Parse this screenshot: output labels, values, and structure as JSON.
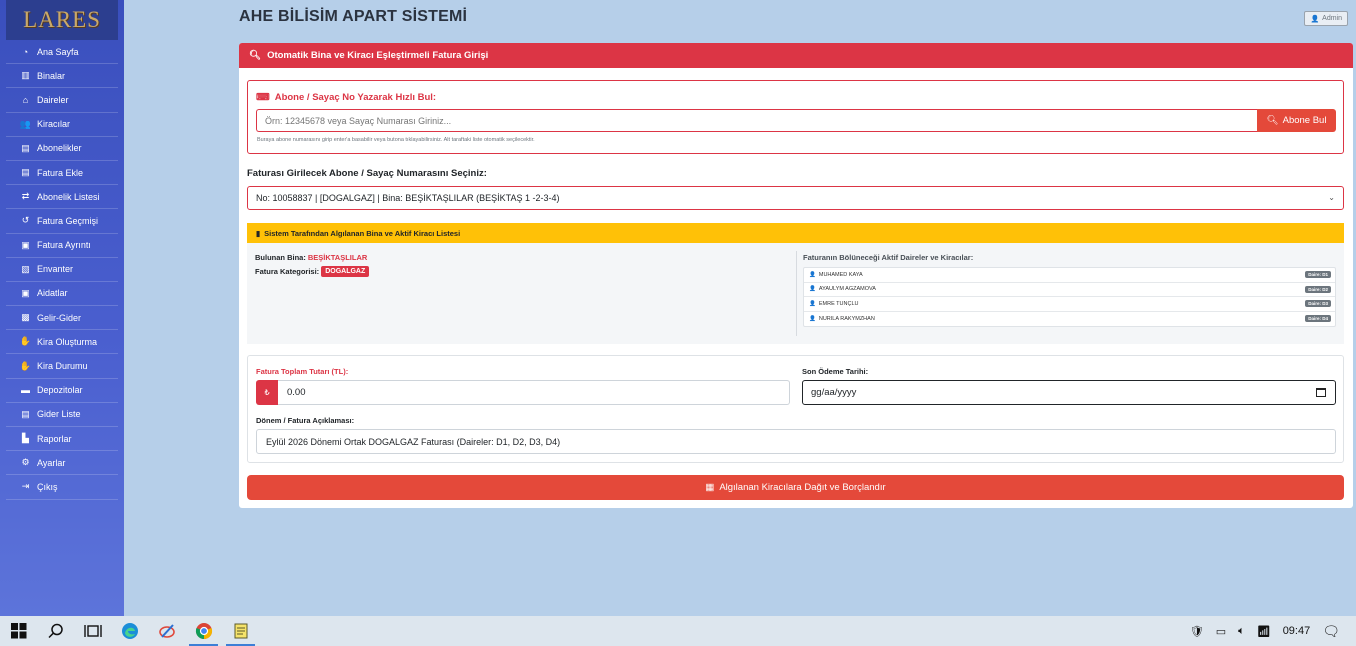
{
  "app": {
    "logo_text": "LARES",
    "page_title": "AHE BİLİSİM APART SİSTEMİ",
    "admin_label": "Admin"
  },
  "sidebar": {
    "items": [
      {
        "label": "Ana Sayfa",
        "icon": "dashboard-icon"
      },
      {
        "label": "Binalar",
        "icon": "building-icon"
      },
      {
        "label": "Daireler",
        "icon": "home-icon"
      },
      {
        "label": "Kiracılar",
        "icon": "users-icon"
      },
      {
        "label": "Abonelikler",
        "icon": "clipboard-icon"
      },
      {
        "label": "Fatura Ekle",
        "icon": "invoice-icon"
      },
      {
        "label": "Abonelik Listesi",
        "icon": "sync-icon"
      },
      {
        "label": "Fatura Geçmişi",
        "icon": "history-icon"
      },
      {
        "label": "Fatura Ayrıntı",
        "icon": "money-icon"
      },
      {
        "label": "Envanter",
        "icon": "box-icon"
      },
      {
        "label": "Aidatlar",
        "icon": "wallet-icon"
      },
      {
        "label": "Gelir-Gider",
        "icon": "cash-icon"
      },
      {
        "label": "Kira Oluşturma",
        "icon": "hand-money-icon"
      },
      {
        "label": "Kira Durumu",
        "icon": "hand-coin-icon"
      },
      {
        "label": "Depozitolar",
        "icon": "deposit-icon"
      },
      {
        "label": "Gider Liste",
        "icon": "list-icon"
      },
      {
        "label": "Raporlar",
        "icon": "chart-icon"
      },
      {
        "label": "Ayarlar",
        "icon": "gear-icon"
      },
      {
        "label": "Çıkış",
        "icon": "logout-icon"
      }
    ]
  },
  "card": {
    "header": "Otomatik Bina ve Kiracı Eşleştirmeli Fatura Girişi"
  },
  "quick_search": {
    "label": "Abone / Sayaç No Yazarak Hızlı Bul:",
    "placeholder": "Örn: 12345678 veya Sayaç Numarası Giriniz...",
    "button": "Abone Bul",
    "help": "Buraya abone numarasını girip enter'a basabilir veya butona tıklayabilirsiniz. Alt taraftaki liste otomatik seçilecektir."
  },
  "subscriber_select": {
    "label": "Faturası Girilecek Abone / Sayaç Numarasını Seçiniz:",
    "value": "No: 10058837 | [DOGALGAZ] | Bina: BEŞİKTAŞLILAR (BEŞİKTAŞ 1 -2-3-4)"
  },
  "detected": {
    "title": "Sistem Tarafından Algılanan Bina ve Aktif Kiracı Listesi",
    "building_label": "Bulunan Bina:",
    "building_value": "BEŞİKTAŞLILAR",
    "category_label": "Fatura Kategorisi:",
    "category_value": "DOGALGAZ",
    "tenants_title": "Faturanın Bölüneceği Aktif Daireler ve Kiracılar:",
    "tenants": [
      {
        "name": "MUHAMED KAYA",
        "badge": "Daire: D1"
      },
      {
        "name": "AYAULYM AGZAMOVA",
        "badge": "Daire: D2"
      },
      {
        "name": "EMRE TUNÇLU",
        "badge": "Daire: D3"
      },
      {
        "name": "NURILA RAKYMZHAN",
        "badge": "Daire: D4"
      }
    ]
  },
  "form": {
    "amount_label": "Fatura Toplam Tutarı (TL):",
    "currency_symbol": "₺",
    "amount_value": "0.00",
    "due_label": "Son Ödeme Tarihi:",
    "due_value": "gg/aa/yyyy",
    "desc_label": "Dönem / Fatura Açıklaması:",
    "desc_value": "Eylül 2026 Dönemi Ortak DOGALGAZ Faturası (Daireler: D1, D2, D3, D4)"
  },
  "submit": {
    "label": "Algılanan Kiracılara Dağıt ve Borçlandır"
  },
  "taskbar": {
    "time": "09:47"
  },
  "colors": {
    "accent": "#dc3545",
    "warning": "#ffc107",
    "sidebar": "#4459c6",
    "background": "#b6cfe9"
  }
}
